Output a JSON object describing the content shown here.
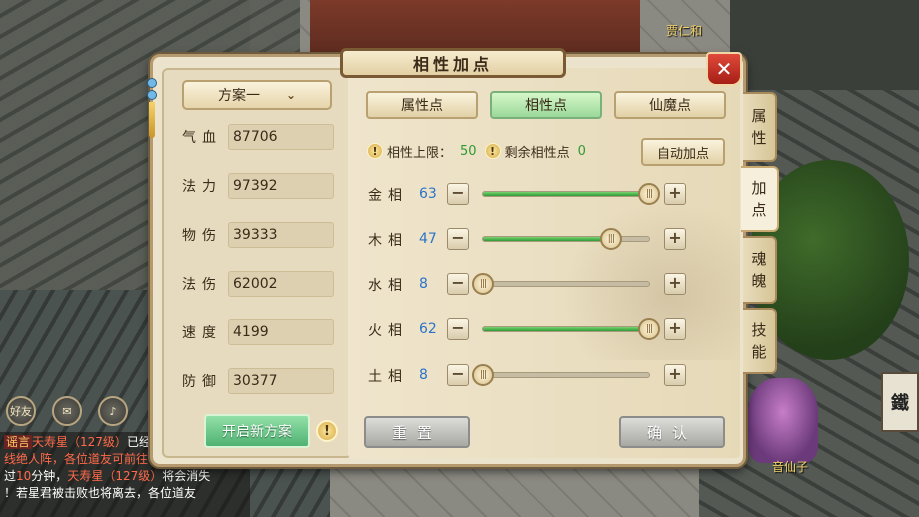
{
  "dialog": {
    "title": "相性加点",
    "close_label": "✕"
  },
  "plan": {
    "selected": "方案一"
  },
  "stats": [
    {
      "label": "气血",
      "value": "87706"
    },
    {
      "label": "法力",
      "value": "97392"
    },
    {
      "label": "物伤",
      "value": "39333"
    },
    {
      "label": "法伤",
      "value": "62002"
    },
    {
      "label": "速度",
      "value": "4199"
    },
    {
      "label": "防御",
      "value": "30377"
    }
  ],
  "new_plan_button": "开启新方案",
  "info_mark": "!",
  "tabs": [
    {
      "label": "属性点",
      "active": false
    },
    {
      "label": "相性点",
      "active": true
    },
    {
      "label": "仙魔点",
      "active": false
    }
  ],
  "limit": {
    "label": "相性上限：",
    "value": "50",
    "remaining_label": "剩余相性点",
    "remaining_value": "0"
  },
  "auto_button": "自动加点",
  "attributes": [
    {
      "name": "金相",
      "value": "63",
      "fraction": 1.0
    },
    {
      "name": "木相",
      "value": "47",
      "fraction": 0.77
    },
    {
      "name": "水相",
      "value": "8",
      "fraction": 0.0
    },
    {
      "name": "火相",
      "value": "62",
      "fraction": 1.0
    },
    {
      "name": "土相",
      "value": "8",
      "fraction": 0.0
    }
  ],
  "minus_label": "−",
  "plus_label": "+",
  "knob_label": "|||",
  "reset_button": "重置",
  "confirm_button": "确认",
  "side_tabs": [
    {
      "label": "属\n性",
      "active": false
    },
    {
      "label": "加\n点",
      "active": true
    },
    {
      "label": "魂\n魄",
      "active": false
    },
    {
      "label": "技\n能",
      "active": false
    }
  ],
  "scene": {
    "npc_top": "贾仁和",
    "npc_bottom": "音仙子",
    "hud_friend": "好友",
    "side_sign": "鐵",
    "chat": [
      {
        "tag": "谣言",
        "name": "天寿星",
        "level": "（127级）",
        "text": "已经"
      },
      {
        "text": "线绝人阵，各位道友可前往"
      },
      {
        "prefix": "过",
        "num": "10",
        "text": "分钟，",
        "name": "天寿星",
        "level": "（127级）",
        "suffix": "将会消失"
      },
      {
        "text": "！若星君被击败也将离去，各位道友"
      }
    ]
  },
  "colors": {
    "accent_green": "#2e9a30",
    "value_blue": "#2a74c8",
    "close_red": "#c82a1e"
  }
}
